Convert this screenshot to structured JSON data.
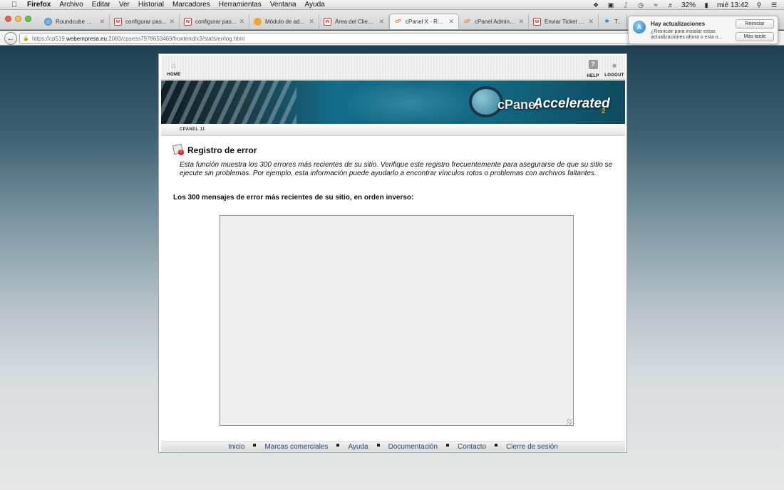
{
  "menubar": {
    "app": "Firefox",
    "items": [
      "Archivo",
      "Editar",
      "Ver",
      "Historial",
      "Marcadores",
      "Herramientas",
      "Ventana",
      "Ayuda"
    ],
    "battery": "32%",
    "clock": "mié 13:42"
  },
  "tabs": [
    {
      "label": "Roundcube We...",
      "favicon": "roundcube-icon"
    },
    {
      "label": "configurar pas...",
      "favicon": "webempresa-icon"
    },
    {
      "label": "configurar pas...",
      "favicon": "webempresa-icon"
    },
    {
      "label": "Módulo de ad...",
      "favicon": "module-icon"
    },
    {
      "label": "Área del Client...",
      "favicon": "webempresa-icon"
    },
    {
      "label": "cPanel X - Regi...",
      "favicon": "cpanel-icon",
      "active": true
    },
    {
      "label": "cPanel Adminis...",
      "favicon": "cpanel-icon"
    },
    {
      "label": "Enviar Ticket d...",
      "favicon": "webempresa-icon"
    },
    {
      "label": "TIE",
      "favicon": "joomla-icon"
    }
  ],
  "url": {
    "prefix": "https://cp519.",
    "host": "webempresa.eu",
    "path": ":2083/cpsess7978653469/frontend/x3/stats/errlog.html"
  },
  "notification": {
    "title": "Hay actualizaciones",
    "body": "¿Reiniciar para instalar estas actualizaciones ahora o esta n...",
    "restart_label": "Reiniciar",
    "later_label": "Más tarde"
  },
  "cpanel": {
    "home_label": "HOME",
    "help_label": "HELP",
    "logout_label": "LOGOUT",
    "banner_logo_text": "cPanel",
    "banner_accelerated": "Accelerated",
    "banner_version_sub": "2",
    "version_label": "CPANEL 11",
    "page_title": "Registro de error",
    "description": "Esta función muestra los 300 errores más recientes de su sitio. Verifique este registro frecuentemente para asegurarse de que su sitio se ejecute sin problemas. Por ejemplo, esta información puede ayudarlo a encontrar vínculos rotos o problemas con archivos faltantes.",
    "subtitle": "Los 300 mensajes de error más recientes de su sitio, en orden inverso:",
    "log_content": ""
  },
  "footer": {
    "links": [
      "Inicio",
      "Marcas comerciales",
      "Ayuda",
      "Documentación",
      "Contacto",
      "Cierre de sesión"
    ]
  }
}
